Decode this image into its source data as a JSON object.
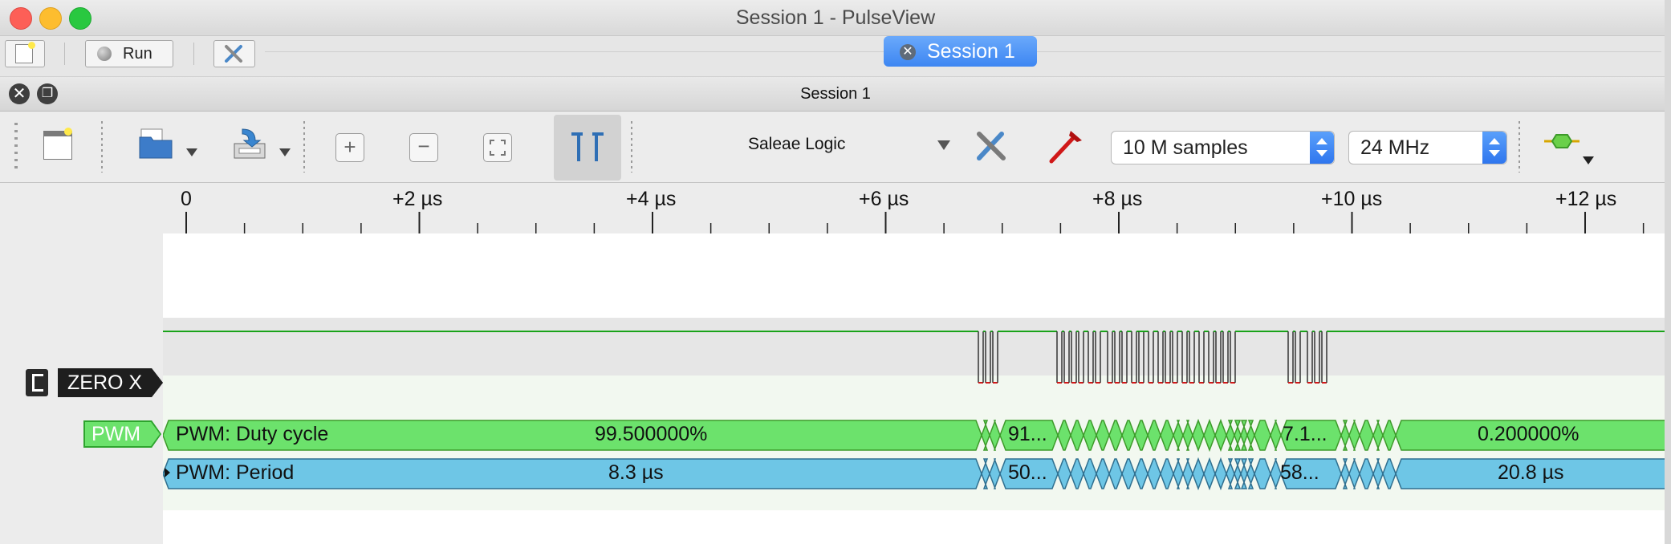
{
  "window": {
    "title": "Session 1 - PulseView"
  },
  "top_bar": {
    "run_label": "Run",
    "session_tab_label": "Session 1"
  },
  "session_header": {
    "title": "Session 1"
  },
  "toolbar": {
    "device_label": "Saleae Logic",
    "samples_value": "10 M samples",
    "rate_value": "24 MHz"
  },
  "ruler": {
    "ticks": [
      "0",
      "+2 µs",
      "+4 µs",
      "+6 µs",
      "+8 µs",
      "+10 µs",
      "+12 µs"
    ]
  },
  "channels": {
    "zero_x_label": "ZERO X",
    "pwm_label": "PWM"
  },
  "decoder": {
    "duty_row_label": "PWM: Duty cycle",
    "period_row_label": "PWM: Period",
    "duty_values": [
      "99.500000%",
      "91...",
      "7.1...",
      "0.200000%"
    ],
    "period_values": [
      "8.3 µs",
      "50...",
      "58...",
      "20.8 µs"
    ]
  },
  "colors": {
    "accent_blue": "#3d86f2",
    "duty_green": "#6ce26c",
    "period_blue": "#6ec6e6",
    "signal_high": "#1aa31a",
    "signal_low": "#d21a1a"
  }
}
